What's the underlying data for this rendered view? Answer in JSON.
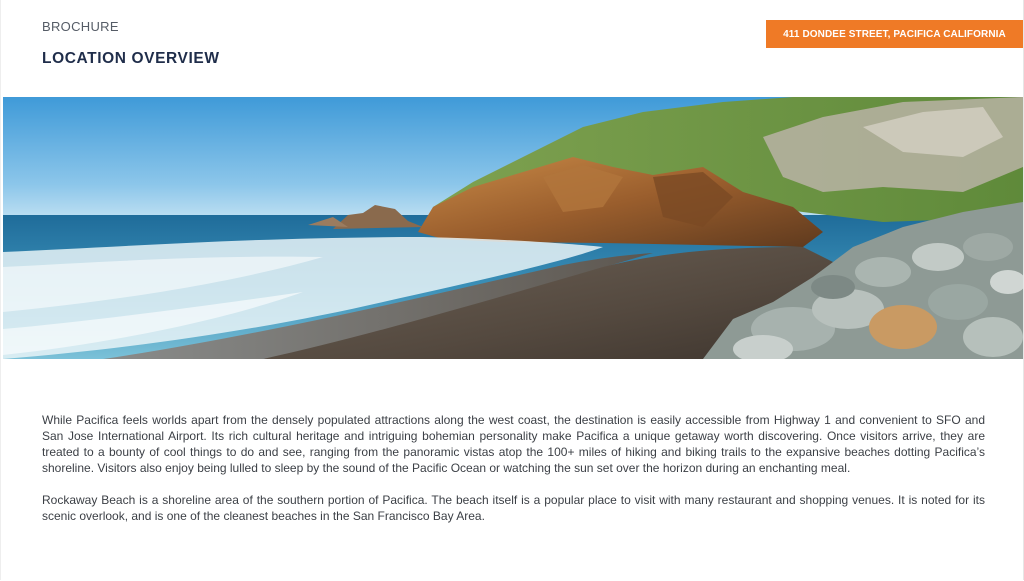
{
  "header": {
    "eyebrow": "BROCHURE",
    "title": "LOCATION OVERVIEW",
    "address_badge": "411 DONDEE STREET, PACIFICA CALIFORNIA"
  },
  "hero_image": {
    "subject": "beach-coastline-photo"
  },
  "content": {
    "paragraph_1": "While Pacifica feels worlds apart from the densely populated attractions along the west coast, the destination is easily accessible from Highway 1 and convenient to SFO and San Jose International Airport. Its rich cultural heritage and intriguing bohemian personality make Pacifica a unique getaway worth discovering. Once visitors arrive, they are treated to a bounty of cool things to do and see, ranging from the panoramic vistas atop the 100+ miles of hiking and biking trails to the expansive beaches dotting Pacifica’s shoreline. Visitors also enjoy being lulled to sleep by the sound of the Pacific Ocean or watching the sun set over the horizon during an enchanting meal.",
    "paragraph_2": " Rockaway Beach is a shoreline area of the southern portion of Pacifica. The beach itself is a popular place to visit with many restaurant and shopping venues. It is noted for its scenic overlook, and is one of the cleanest beaches in the San Francisco Bay Area."
  },
  "colors": {
    "accent": "#ef7a26",
    "title": "#1f2d4a",
    "text": "#3b3f45"
  }
}
